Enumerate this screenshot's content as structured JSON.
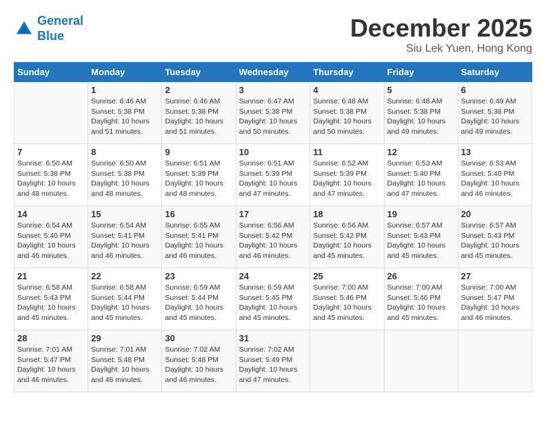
{
  "header": {
    "logo_line1": "General",
    "logo_line2": "Blue",
    "month": "December 2025",
    "location": "Siu Lek Yuen, Hong Kong"
  },
  "weekdays": [
    "Sunday",
    "Monday",
    "Tuesday",
    "Wednesday",
    "Thursday",
    "Friday",
    "Saturday"
  ],
  "weeks": [
    [
      {
        "day": "",
        "info": ""
      },
      {
        "day": "1",
        "info": "Sunrise: 6:46 AM\nSunset: 5:38 PM\nDaylight: 10 hours\nand 51 minutes."
      },
      {
        "day": "2",
        "info": "Sunrise: 6:46 AM\nSunset: 5:38 PM\nDaylight: 10 hours\nand 51 minutes."
      },
      {
        "day": "3",
        "info": "Sunrise: 6:47 AM\nSunset: 5:38 PM\nDaylight: 10 hours\nand 50 minutes."
      },
      {
        "day": "4",
        "info": "Sunrise: 6:48 AM\nSunset: 5:38 PM\nDaylight: 10 hours\nand 50 minutes."
      },
      {
        "day": "5",
        "info": "Sunrise: 6:48 AM\nSunset: 5:38 PM\nDaylight: 10 hours\nand 49 minutes."
      },
      {
        "day": "6",
        "info": "Sunrise: 6:49 AM\nSunset: 5:38 PM\nDaylight: 10 hours\nand 49 minutes."
      }
    ],
    [
      {
        "day": "7",
        "info": "Sunrise: 6:50 AM\nSunset: 5:38 PM\nDaylight: 10 hours\nand 48 minutes."
      },
      {
        "day": "8",
        "info": "Sunrise: 6:50 AM\nSunset: 5:38 PM\nDaylight: 10 hours\nand 48 minutes."
      },
      {
        "day": "9",
        "info": "Sunrise: 6:51 AM\nSunset: 5:39 PM\nDaylight: 10 hours\nand 48 minutes."
      },
      {
        "day": "10",
        "info": "Sunrise: 6:51 AM\nSunset: 5:39 PM\nDaylight: 10 hours\nand 47 minutes."
      },
      {
        "day": "11",
        "info": "Sunrise: 6:52 AM\nSunset: 5:39 PM\nDaylight: 10 hours\nand 47 minutes."
      },
      {
        "day": "12",
        "info": "Sunrise: 6:53 AM\nSunset: 5:40 PM\nDaylight: 10 hours\nand 47 minutes."
      },
      {
        "day": "13",
        "info": "Sunrise: 6:53 AM\nSunset: 5:40 PM\nDaylight: 10 hours\nand 46 minutes."
      }
    ],
    [
      {
        "day": "14",
        "info": "Sunrise: 6:54 AM\nSunset: 5:40 PM\nDaylight: 10 hours\nand 46 minutes."
      },
      {
        "day": "15",
        "info": "Sunrise: 6:54 AM\nSunset: 5:41 PM\nDaylight: 10 hours\nand 46 minutes."
      },
      {
        "day": "16",
        "info": "Sunrise: 6:55 AM\nSunset: 5:41 PM\nDaylight: 10 hours\nand 46 minutes."
      },
      {
        "day": "17",
        "info": "Sunrise: 6:56 AM\nSunset: 5:42 PM\nDaylight: 10 hours\nand 46 minutes."
      },
      {
        "day": "18",
        "info": "Sunrise: 6:56 AM\nSunset: 5:42 PM\nDaylight: 10 hours\nand 45 minutes."
      },
      {
        "day": "19",
        "info": "Sunrise: 6:57 AM\nSunset: 5:43 PM\nDaylight: 10 hours\nand 45 minutes."
      },
      {
        "day": "20",
        "info": "Sunrise: 6:57 AM\nSunset: 5:43 PM\nDaylight: 10 hours\nand 45 minutes."
      }
    ],
    [
      {
        "day": "21",
        "info": "Sunrise: 6:58 AM\nSunset: 5:43 PM\nDaylight: 10 hours\nand 45 minutes."
      },
      {
        "day": "22",
        "info": "Sunrise: 6:58 AM\nSunset: 5:44 PM\nDaylight: 10 hours\nand 45 minutes."
      },
      {
        "day": "23",
        "info": "Sunrise: 6:59 AM\nSunset: 5:44 PM\nDaylight: 10 hours\nand 45 minutes."
      },
      {
        "day": "24",
        "info": "Sunrise: 6:59 AM\nSunset: 5:45 PM\nDaylight: 10 hours\nand 45 minutes."
      },
      {
        "day": "25",
        "info": "Sunrise: 7:00 AM\nSunset: 5:46 PM\nDaylight: 10 hours\nand 45 minutes."
      },
      {
        "day": "26",
        "info": "Sunrise: 7:00 AM\nSunset: 5:46 PM\nDaylight: 10 hours\nand 45 minutes."
      },
      {
        "day": "27",
        "info": "Sunrise: 7:00 AM\nSunset: 5:47 PM\nDaylight: 10 hours\nand 46 minutes."
      }
    ],
    [
      {
        "day": "28",
        "info": "Sunrise: 7:01 AM\nSunset: 5:47 PM\nDaylight: 10 hours\nand 46 minutes."
      },
      {
        "day": "29",
        "info": "Sunrise: 7:01 AM\nSunset: 5:48 PM\nDaylight: 10 hours\nand 46 minutes."
      },
      {
        "day": "30",
        "info": "Sunrise: 7:02 AM\nSunset: 5:48 PM\nDaylight: 10 hours\nand 46 minutes."
      },
      {
        "day": "31",
        "info": "Sunrise: 7:02 AM\nSunset: 5:49 PM\nDaylight: 10 hours\nand 47 minutes."
      },
      {
        "day": "",
        "info": ""
      },
      {
        "day": "",
        "info": ""
      },
      {
        "day": "",
        "info": ""
      }
    ]
  ]
}
